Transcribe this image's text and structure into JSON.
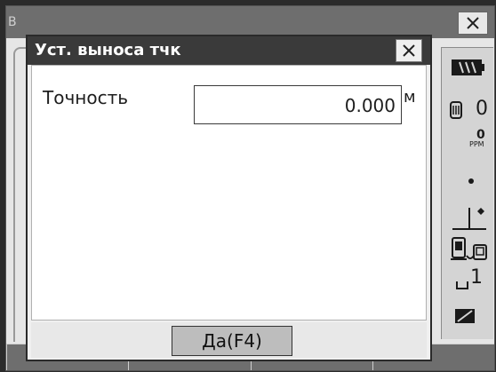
{
  "background_window": {
    "title_fragment": "B",
    "close_icon": "close-icon"
  },
  "dialog": {
    "title": "Уст. выноса тчк",
    "close_icon": "close-icon",
    "field": {
      "label": "Точность",
      "value": "0.000",
      "unit": "м"
    },
    "ok_label": "Да(F4)"
  },
  "status_panel": {
    "battery_icon": "battery-icon",
    "prism_constant_icon": "prism-icon",
    "prism_constant": "0",
    "ppm_value": "0",
    "ppm_label": "PPM",
    "laser_dot_icon": "laser-point-icon",
    "tilt_icon": "tilt-compensation-icon",
    "comm_icon": "bluetooth-device-icon",
    "input_mode": "1",
    "input_mode_icon": "input-mode-icon",
    "memory_icon": "memory-card-icon"
  },
  "softkeys": [
    "",
    "",
    "",
    ""
  ],
  "colors": {
    "dialog_title_bg": "#3a3a3a",
    "panel_bg": "#d4d4d4",
    "button_bg": "#bdbdbd"
  }
}
